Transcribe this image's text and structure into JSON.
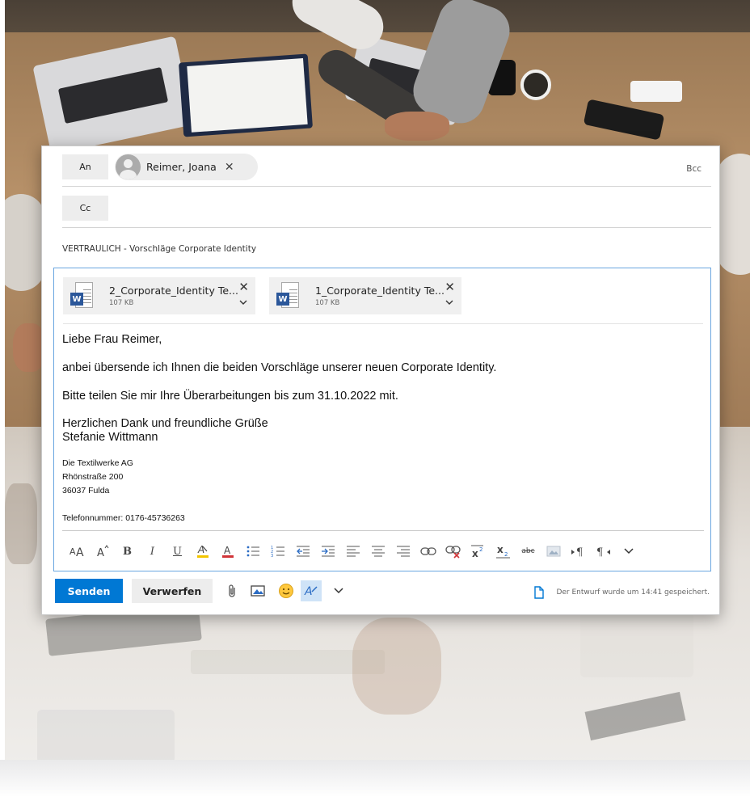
{
  "recipients": {
    "to_label": "An",
    "to_chip_name": "Reimer, Joana",
    "to_chip_remove": "✕",
    "cc_label": "Cc",
    "bcc_label": "Bcc"
  },
  "subject": "VERTRAULICH - Vorschläge Corporate Identity",
  "attachments": [
    {
      "name": "2_Corporate_Identity Te...",
      "size": "107 KB",
      "icon": "word-file-icon"
    },
    {
      "name": "1_Corporate_Identity Te...",
      "size": "107 KB",
      "icon": "word-file-icon"
    }
  ],
  "attachment_badge": "W",
  "attachment_remove": "✕",
  "body": {
    "greeting": "Liebe Frau Reimer,",
    "paragraph1": "anbei übersende ich Ihnen die beiden Vorschläge unserer neuen Corporate Identity.",
    "paragraph2": "Bitte teilen Sie mir Ihre Überarbeitungen bis zum 31.10.2022 mit.",
    "closing": "Herzlichen Dank und freundliche Grüße",
    "sender_name": "Stefanie Wittmann"
  },
  "signature": {
    "company": "Die Textilwerke AG",
    "street": "Rhönstraße 200",
    "city": "36037 Fulda",
    "phone": "Telefonnummer: 0176-45736263"
  },
  "format_toolbar": [
    "font-size-icon",
    "grow-font-icon",
    "bold-icon",
    "italic-icon",
    "underline-icon",
    "highlight-icon",
    "font-color-icon",
    "bullets-icon",
    "numbering-icon",
    "decrease-indent-icon",
    "increase-indent-icon",
    "align-left-icon",
    "align-center-icon",
    "align-right-icon",
    "insert-link-icon",
    "remove-link-icon",
    "superscript-icon",
    "subscript-icon",
    "strikethrough-icon",
    "insert-image-icon",
    "ltr-icon",
    "rtl-icon",
    "more-options-chevron-icon"
  ],
  "format_labels": {
    "bold": "B",
    "italic": "I",
    "underline": "U",
    "strikethrough": "abc"
  },
  "actions": {
    "send_label": "Senden",
    "discard_label": "Verwerfen",
    "draft_status": "Der Entwurf wurde um 14:41 gespeichert."
  },
  "colors": {
    "accent": "#0078d4",
    "editor_border": "#6aa6e0",
    "highlight_yellow": "#f2c500",
    "font_color_red": "#d13438",
    "word_blue": "#2b579a"
  }
}
